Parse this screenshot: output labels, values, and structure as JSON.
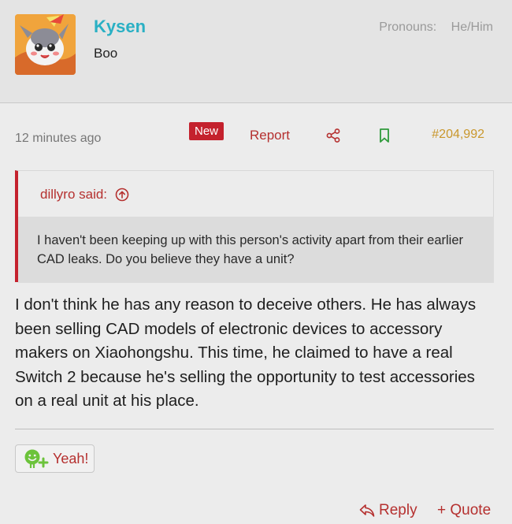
{
  "user": {
    "name": "Kysen",
    "title": "Boo",
    "pronouns_label": "Pronouns:",
    "pronouns_value": "He/Him",
    "avatar_icon": "pokemon-avatar-icon"
  },
  "post": {
    "timestamp": "12 minutes ago",
    "new_badge": "New",
    "report_label": "Report",
    "post_number": "#204,992",
    "share_icon": "share-icon",
    "bookmark_icon": "bookmark-icon"
  },
  "quote": {
    "attribution": "dillyro said:",
    "text": "I haven't been keeping up with this person's activity apart from their earlier CAD leaks. Do you believe they have a unit?"
  },
  "body": {
    "text": "I don't think he has any reason to deceive others. He has always been selling CAD models of electronic devices to accessory makers on Xiaohongshu. This time, he claimed to have a real Switch 2 because he's selling the opportunity to test accessories on a real unit at his place."
  },
  "reaction": {
    "label": "Yeah!",
    "icon": "smile-plus-icon"
  },
  "actions": {
    "reply_label": "Reply",
    "quote_label": "+ Quote"
  },
  "colors": {
    "accent": "#b5302f",
    "username": "#2ab0c4",
    "post_number": "#c9972c",
    "badge_bg": "#c4212d"
  }
}
